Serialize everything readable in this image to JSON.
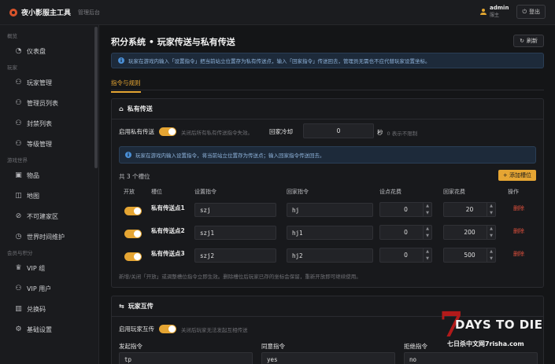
{
  "header": {
    "app_title": "夜小影服主工具",
    "app_subtitle": "管理后台",
    "user_name": "admin",
    "user_role": "服主",
    "logout_label": "登出"
  },
  "sidebar": {
    "groups": [
      {
        "title": "概览",
        "items": [
          {
            "label": "仪表盘",
            "icon": "dashboard-icon"
          }
        ]
      },
      {
        "title": "玩家",
        "items": [
          {
            "label": "玩家管理",
            "icon": "user-icon"
          },
          {
            "label": "管理员列表",
            "icon": "user-icon"
          },
          {
            "label": "封禁列表",
            "icon": "user-icon"
          },
          {
            "label": "等级管理",
            "icon": "user-icon"
          }
        ]
      },
      {
        "title": "游戏世界",
        "items": [
          {
            "label": "物品",
            "icon": "box-icon"
          },
          {
            "label": "地图",
            "icon": "map-icon"
          },
          {
            "label": "不可建家区",
            "icon": "ban-icon"
          },
          {
            "label": "世界时间维护",
            "icon": "clock-icon"
          }
        ]
      },
      {
        "title": "会员与积分",
        "items": [
          {
            "label": "VIP 组",
            "icon": "vip-icon"
          },
          {
            "label": "VIP 用户",
            "icon": "user-icon"
          },
          {
            "label": "兑换码",
            "icon": "barcode-icon"
          },
          {
            "label": "基础设置",
            "icon": "gear-icon"
          }
        ]
      }
    ]
  },
  "page": {
    "title": "积分系统 • 玩家传送与私有传送",
    "refresh_label": "刷新",
    "info": "玩家在游戏内输入「设置指令」把当前站立位置存为私有传送点，输入「回家指令」传送回去，管理员无需也不应代替玩家设置坐标。",
    "tab": "指令与规则"
  },
  "private_tp": {
    "title": "私有传送",
    "enable_label": "启用私有传送",
    "enable_hint": "关闭后所有私有传送指令失效。",
    "cooldown_label": "回家冷却",
    "cooldown_value": "0",
    "cooldown_unit": "秒",
    "cooldown_hint": "0 表示不限制",
    "info": "玩家在游戏内输入设置指令，将当前站立位置存为传送点；输入回家指令传送回去。",
    "slot_count": "共 3 个槽位",
    "add_label": "+ 添加槽位",
    "columns": [
      "开放",
      "槽位",
      "设置指令",
      "回家指令",
      "设点花费",
      "回家花费",
      "操作"
    ],
    "rows": [
      {
        "name": "私有传送点1",
        "set_cmd": "szj",
        "home_cmd": "hj",
        "set_cost": "0",
        "home_cost": "20",
        "action": "删除"
      },
      {
        "name": "私有传送点2",
        "set_cmd": "szj1",
        "home_cmd": "hj1",
        "set_cost": "0",
        "home_cost": "200",
        "action": "删除"
      },
      {
        "name": "私有传送点3",
        "set_cmd": "szj2",
        "home_cmd": "hj2",
        "set_cost": "0",
        "home_cost": "500",
        "action": "删除"
      }
    ],
    "footer_hint": "新增/关闭「开放」或调整槽位指令立即生效。删除槽位后玩家已存的坐标会保留，重新开放即可继续使用。"
  },
  "player_tp": {
    "title": "玩家互传",
    "enable_label": "启用玩家互传",
    "enable_hint": "关闭后玩家无法发起互相传送",
    "columns": [
      "发起指令",
      "同意指令",
      "拒绝指令"
    ],
    "values": [
      "tp",
      "yes",
      "no"
    ]
  },
  "watermark": {
    "seven": "7",
    "title": "DAYS TO DIE",
    "sub": "七日杀中文网7risha.com"
  },
  "colors": {
    "accent": "#e5a533",
    "danger": "#e0503c",
    "info_bg": "#1d2a3a"
  }
}
